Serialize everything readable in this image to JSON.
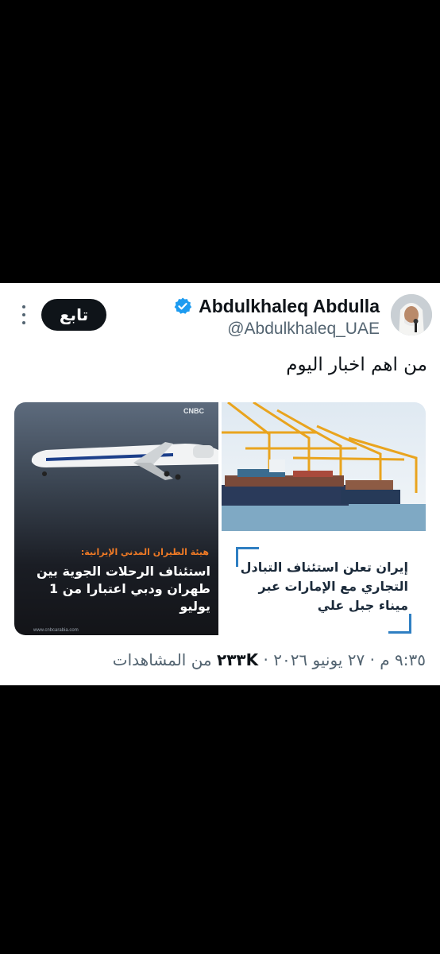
{
  "tweet": {
    "display_name": "Abdulkhaleq Abdulla",
    "handle": "@Abdulkhaleq_UAE",
    "follow_label": "تابع",
    "text": "من اهم اخبار اليوم",
    "media": {
      "right_caption": "إيران تعلن استئناف التبادل التجاري مع الإمارات عبر ميناء جبل علي",
      "left_logo": "CNBC",
      "left_subtitle": "هيئة الطيران المدني الإيرانية:",
      "left_headline": "استئناف الرحلات الجوية بين طهران ودبي اعتبارا من 1 يوليو",
      "left_url": "www.cnbcarabia.com"
    },
    "meta": {
      "time": "٩:٣٥ م",
      "date": "٢٧ يونيو ٢٠٢٦",
      "views_count": "٢٣٣K",
      "views_label": "من المشاهدات",
      "separator": "·"
    }
  },
  "colors": {
    "accent": "#1d9bf0",
    "text": "#0f1419",
    "muted": "#536471",
    "follow_bg": "#0f1419"
  }
}
